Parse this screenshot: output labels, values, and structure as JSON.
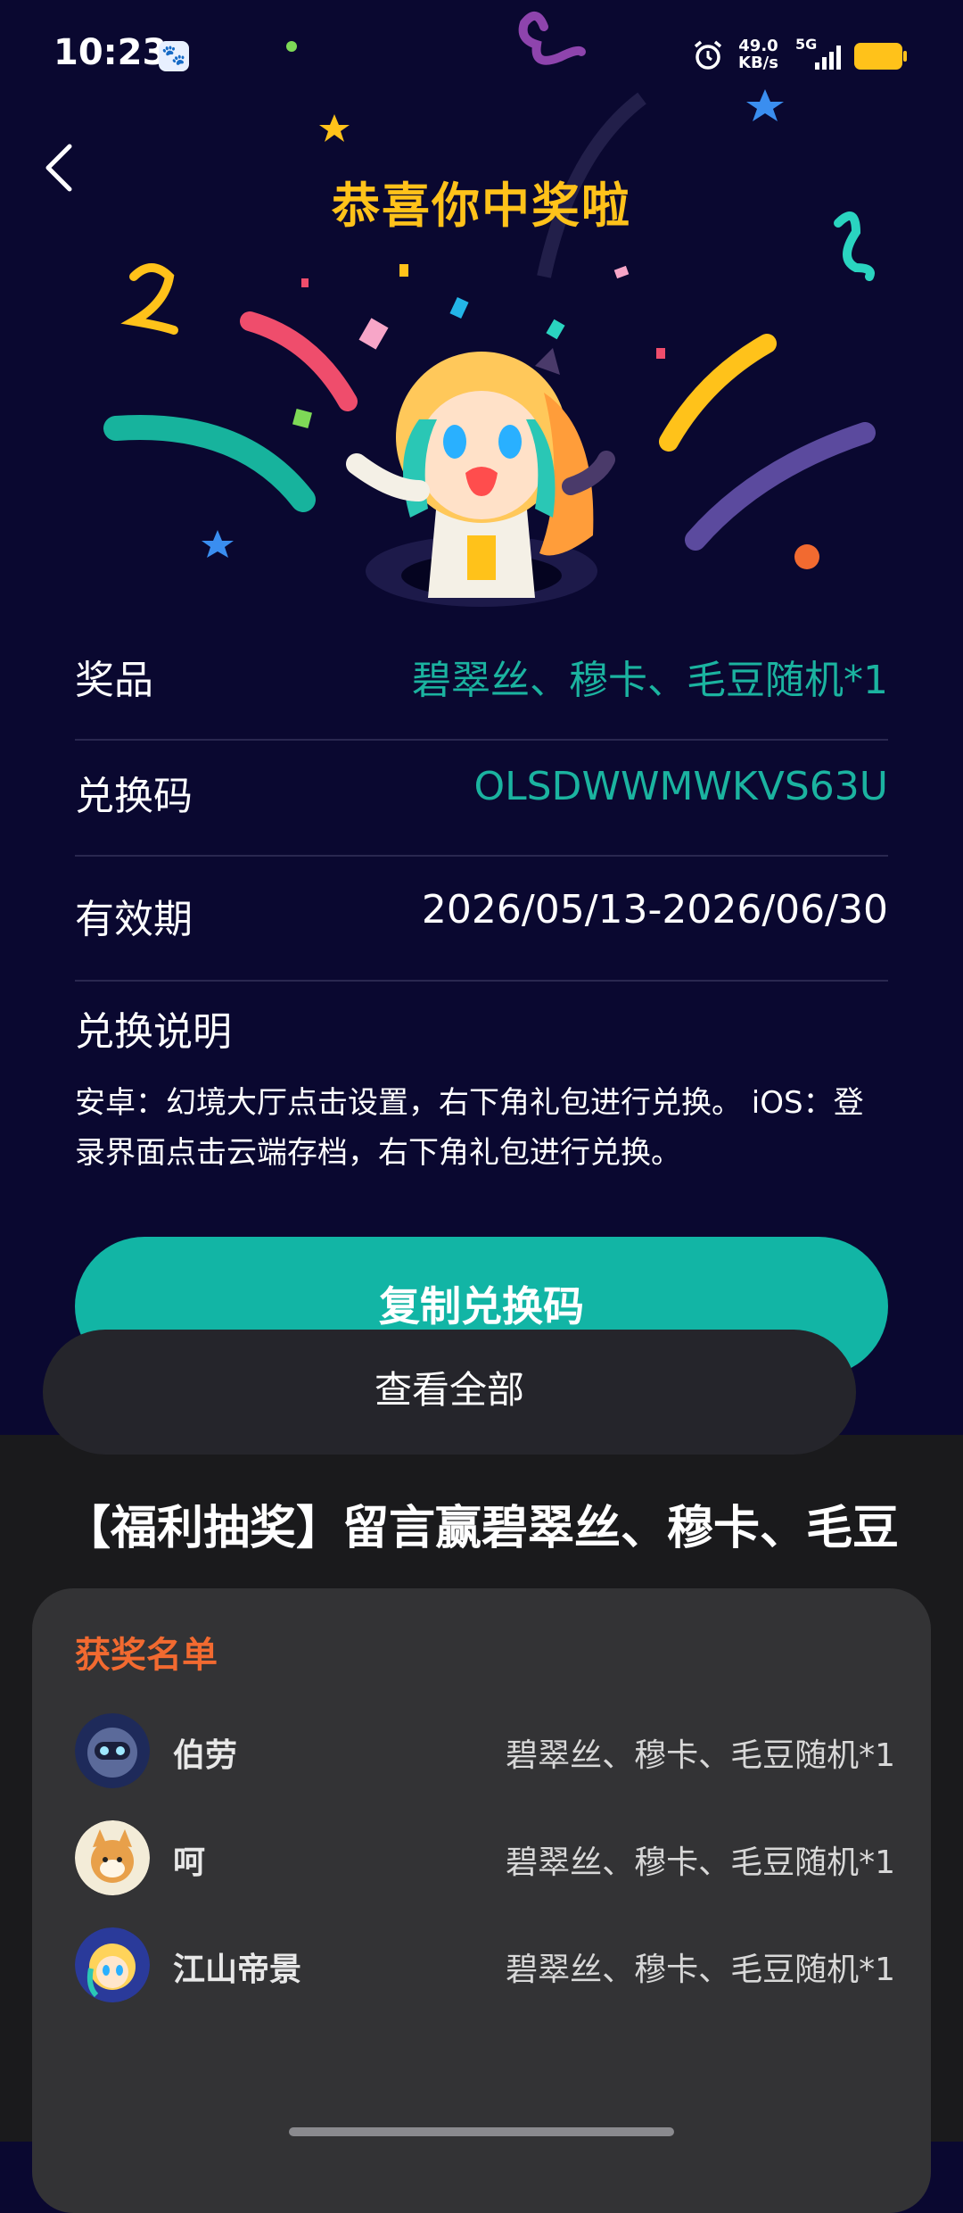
{
  "status_bar": {
    "time": "10:23",
    "net_speed_value": "49.0",
    "net_speed_unit": "KB/s",
    "network": "5G",
    "icons": [
      "baidu-app-icon",
      "alarm-icon",
      "signal-icon",
      "battery-icon"
    ]
  },
  "header": {
    "title": "恭喜你中奖啦",
    "back_icon": "chevron-left-icon"
  },
  "prize_info": {
    "prize_label": "奖品",
    "prize_value": "碧翠丝、穆卡、毛豆随机*1",
    "code_label": "兑换码",
    "code_value": "OLSDWWMWKVS63U",
    "validity_label": "有效期",
    "validity_value": "2026/05/13-2026/06/30",
    "instructions_label": "兑换说明",
    "instructions_text": "安卓：幻境大厅点击设置，右下角礼包进行兑换。 iOS：登录界面点击云端存档，右下角礼包进行兑换。"
  },
  "copy_button": "复制兑换码",
  "post": {
    "title": "【福利抽奖】留言赢碧翠丝、穆卡、毛豆"
  },
  "winners": {
    "heading": "获奖名单",
    "list": [
      {
        "name": "伯劳",
        "prize": "碧翠丝、穆卡、毛豆随机*1"
      },
      {
        "name": "呵",
        "prize": "碧翠丝、穆卡、毛豆随机*1"
      },
      {
        "name": "江山帝景",
        "prize": "碧翠丝、穆卡、毛豆随机*1"
      }
    ],
    "view_all": "查看全部"
  },
  "colors": {
    "background": "#0a0830",
    "title": "#ffc21a",
    "accent_teal": "#12b5a5",
    "winners_heading": "#f26a30"
  }
}
